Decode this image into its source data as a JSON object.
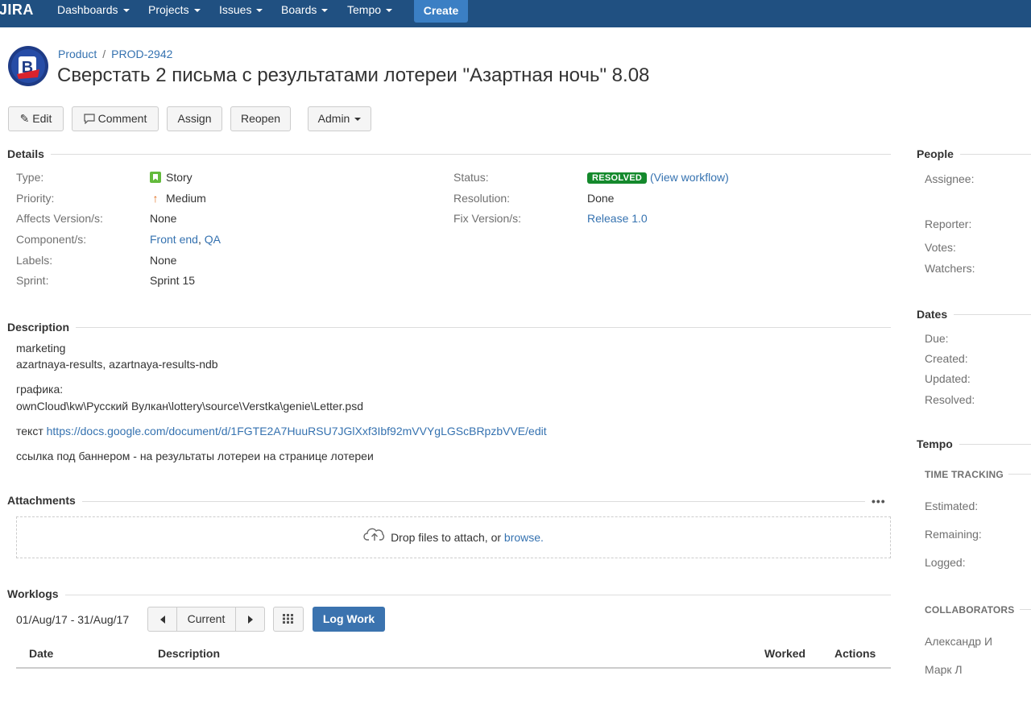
{
  "nav": {
    "logo": "JIRA",
    "items": [
      {
        "label": "Dashboards"
      },
      {
        "label": "Projects"
      },
      {
        "label": "Issues"
      },
      {
        "label": "Boards"
      },
      {
        "label": "Tempo"
      }
    ],
    "create_label": "Create"
  },
  "header": {
    "breadcrumb_project": "Product",
    "breadcrumb_issue": "PROD-2942",
    "title": "Сверстать 2 письма с результатами лотереи \"Азартная ночь\" 8.08"
  },
  "toolbar": {
    "edit": "Edit",
    "comment": "Comment",
    "assign": "Assign",
    "reopen": "Reopen",
    "admin": "Admin"
  },
  "details": {
    "heading": "Details",
    "left": [
      {
        "label": "Type:",
        "value": "Story"
      },
      {
        "label": "Priority:",
        "value": "Medium"
      },
      {
        "label": "Affects Version/s:",
        "value": "None"
      },
      {
        "label": "Component/s:",
        "value": [
          "Front end",
          "QA"
        ]
      },
      {
        "label": "Labels:",
        "value": "None"
      },
      {
        "label": "Sprint:",
        "value": "Sprint 15"
      }
    ],
    "right": [
      {
        "label": "Status:",
        "value": "RESOLVED",
        "link": "View workflow"
      },
      {
        "label": "Resolution:",
        "value": "Done"
      },
      {
        "label": "Fix Version/s:",
        "value": "Release 1.0"
      }
    ],
    "component_separator": ", "
  },
  "description": {
    "heading": "Description",
    "line1": "marketing",
    "line2": "azartnaya-results, azartnaya-results-ndb",
    "line3": "графика:",
    "line4": "ownCloud\\kw\\Русский Вулкан\\lottery\\source\\Verstka\\genie\\Letter.psd",
    "line5_prefix": "текст ",
    "line5_link": "https://docs.google.com/document/d/1FGTE2A7HuuRSU7JGlXxf3Ibf92mVVYgLGScBRpzbVVE/edit",
    "line6": "ссылка под баннером - на результаты лотереи на странице лотереи"
  },
  "attachments": {
    "heading": "Attachments",
    "drop_text": "Drop files to attach, or ",
    "browse": "browse."
  },
  "worklogs": {
    "heading": "Worklogs",
    "date_range": "01/Aug/17 - 31/Aug/17",
    "current": "Current",
    "log_work": "Log Work",
    "columns": [
      "Date",
      "Description",
      "Worked",
      "Actions"
    ]
  },
  "sidebar": {
    "people": {
      "heading": "People",
      "fields": [
        "Assignee:",
        "Reporter:",
        "Votes:",
        "Watchers:"
      ]
    },
    "dates": {
      "heading": "Dates",
      "fields": [
        "Due:",
        "Created:",
        "Updated:",
        "Resolved:"
      ]
    },
    "tempo": {
      "heading": "Tempo",
      "time_tracking": "TIME TRACKING",
      "fields": [
        "Estimated:",
        "Remaining:",
        "Logged:"
      ],
      "collaborators": "COLLABORATORS",
      "people": [
        "Александр И",
        "Марк Л"
      ]
    }
  },
  "colors": {
    "nav_bg": "#205081",
    "create_btn": "#3b7fc4",
    "link": "#3572b0",
    "resolved": "#14892c",
    "story": "#63ba3c",
    "log_work_btn": "#3b73af"
  }
}
